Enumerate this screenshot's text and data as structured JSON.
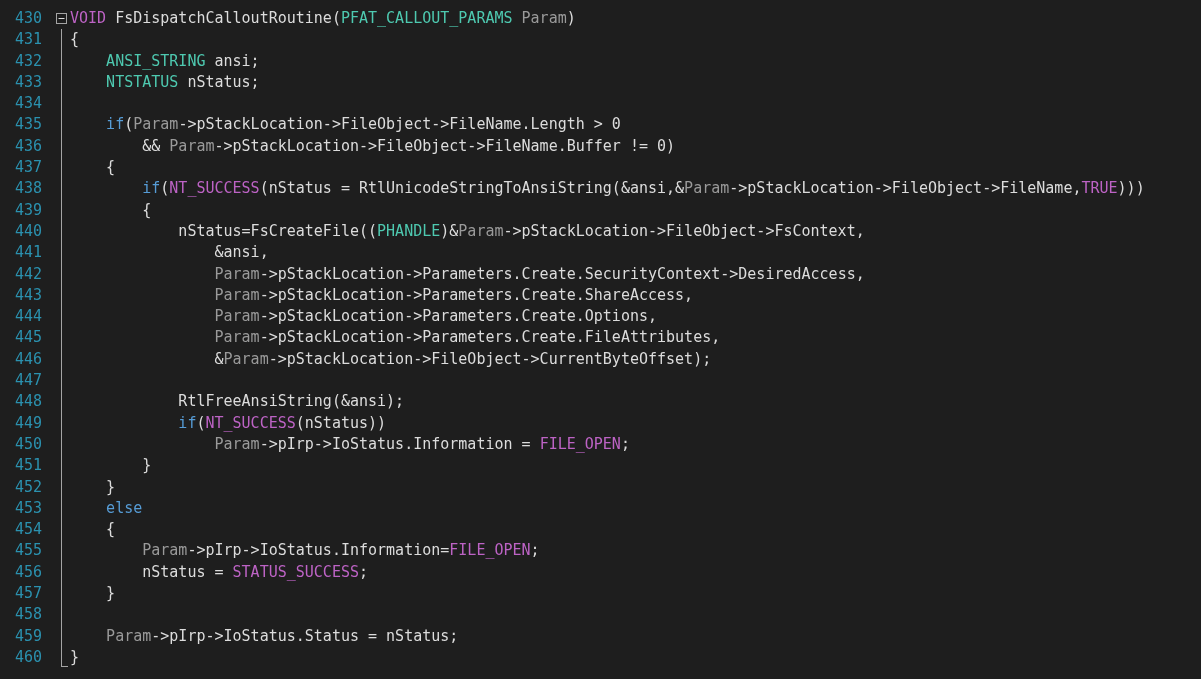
{
  "editor": {
    "fold_region": {
      "expanded": true
    },
    "lines": [
      {
        "number": "430",
        "segments": [
          {
            "text": "VOID",
            "kind": "macro"
          },
          {
            "text": " FsDispatchCalloutRoutine(",
            "kind": "plain"
          },
          {
            "text": "PFAT_CALLOUT_PARAMS ",
            "kind": "type"
          },
          {
            "text": "Param",
            "kind": "param"
          },
          {
            "text": ")",
            "kind": "plain"
          }
        ]
      },
      {
        "number": "431",
        "segments": [
          {
            "text": "{",
            "kind": "plain"
          }
        ]
      },
      {
        "number": "432",
        "segments": [
          {
            "text": "    ANSI_STRING",
            "kind": "type"
          },
          {
            "text": " ansi;",
            "kind": "plain"
          }
        ]
      },
      {
        "number": "433",
        "segments": [
          {
            "text": "    NTSTATUS",
            "kind": "type"
          },
          {
            "text": " nStatus;",
            "kind": "plain"
          }
        ]
      },
      {
        "number": "434"
      },
      {
        "number": "435",
        "segments": [
          {
            "text": "    if",
            "kind": "keyword"
          },
          {
            "text": "(",
            "kind": "plain"
          },
          {
            "text": "Param",
            "kind": "param"
          },
          {
            "text": "->pStackLocation->FileObject->FileName.Length > 0",
            "kind": "plain"
          }
        ]
      },
      {
        "number": "436",
        "segments": [
          {
            "text": "        && ",
            "kind": "plain"
          },
          {
            "text": "Param",
            "kind": "param"
          },
          {
            "text": "->pStackLocation->FileObject->FileName.Buffer != 0)",
            "kind": "plain"
          }
        ]
      },
      {
        "number": "437",
        "segments": [
          {
            "text": "    {",
            "kind": "plain"
          }
        ]
      },
      {
        "number": "438",
        "segments": [
          {
            "text": "        if",
            "kind": "keyword"
          },
          {
            "text": "(",
            "kind": "plain"
          },
          {
            "text": "NT_SUCCESS",
            "kind": "macro"
          },
          {
            "text": "(nStatus = RtlUnicodeStringToAnsiString(&ansi,&",
            "kind": "plain"
          },
          {
            "text": "Param",
            "kind": "param"
          },
          {
            "text": "->pStackLocation->FileObject->FileName,",
            "kind": "plain"
          },
          {
            "text": "TRUE",
            "kind": "macro"
          },
          {
            "text": ")))",
            "kind": "plain"
          }
        ]
      },
      {
        "number": "439",
        "segments": [
          {
            "text": "        {",
            "kind": "plain"
          }
        ]
      },
      {
        "number": "440",
        "segments": [
          {
            "text": "            nStatus=FsCreateFile((",
            "kind": "plain"
          },
          {
            "text": "PHANDLE",
            "kind": "type"
          },
          {
            "text": ")&",
            "kind": "plain"
          },
          {
            "text": "Param",
            "kind": "param"
          },
          {
            "text": "->pStackLocation->FileObject->FsContext,",
            "kind": "plain"
          }
        ]
      },
      {
        "number": "441",
        "segments": [
          {
            "text": "                &ansi,",
            "kind": "plain"
          }
        ]
      },
      {
        "number": "442",
        "segments": [
          {
            "text": "                Param",
            "kind": "param"
          },
          {
            "text": "->pStackLocation->Parameters.Create.SecurityContext->DesiredAccess,",
            "kind": "plain"
          }
        ]
      },
      {
        "number": "443",
        "segments": [
          {
            "text": "                Param",
            "kind": "param"
          },
          {
            "text": "->pStackLocation->Parameters.Create.ShareAccess,",
            "kind": "plain"
          }
        ]
      },
      {
        "number": "444",
        "segments": [
          {
            "text": "                Param",
            "kind": "param"
          },
          {
            "text": "->pStackLocation->Parameters.Create.Options,",
            "kind": "plain"
          }
        ]
      },
      {
        "number": "445",
        "segments": [
          {
            "text": "                Param",
            "kind": "param"
          },
          {
            "text": "->pStackLocation->Parameters.Create.FileAttributes,",
            "kind": "plain"
          }
        ]
      },
      {
        "number": "446",
        "segments": [
          {
            "text": "                &",
            "kind": "plain"
          },
          {
            "text": "Param",
            "kind": "param"
          },
          {
            "text": "->pStackLocation->FileObject->CurrentByteOffset);",
            "kind": "plain"
          }
        ]
      },
      {
        "number": "447"
      },
      {
        "number": "448",
        "segments": [
          {
            "text": "            RtlFreeAnsiString(&ansi);",
            "kind": "plain"
          }
        ]
      },
      {
        "number": "449",
        "segments": [
          {
            "text": "            if",
            "kind": "keyword"
          },
          {
            "text": "(",
            "kind": "plain"
          },
          {
            "text": "NT_SUCCESS",
            "kind": "macro"
          },
          {
            "text": "(nStatus))",
            "kind": "plain"
          }
        ]
      },
      {
        "number": "450",
        "segments": [
          {
            "text": "                Param",
            "kind": "param"
          },
          {
            "text": "->pIrp->IoStatus.Information = ",
            "kind": "plain"
          },
          {
            "text": "FILE_OPEN",
            "kind": "macro"
          },
          {
            "text": ";",
            "kind": "plain"
          }
        ]
      },
      {
        "number": "451",
        "segments": [
          {
            "text": "        }",
            "kind": "plain"
          }
        ]
      },
      {
        "number": "452",
        "segments": [
          {
            "text": "    }",
            "kind": "plain"
          }
        ]
      },
      {
        "number": "453",
        "segments": [
          {
            "text": "    else",
            "kind": "keyword"
          }
        ]
      },
      {
        "number": "454",
        "segments": [
          {
            "text": "    {",
            "kind": "plain"
          }
        ]
      },
      {
        "number": "455",
        "segments": [
          {
            "text": "        Param",
            "kind": "param"
          },
          {
            "text": "->pIrp->IoStatus.Information=",
            "kind": "plain"
          },
          {
            "text": "FILE_OPEN",
            "kind": "macro"
          },
          {
            "text": ";",
            "kind": "plain"
          }
        ]
      },
      {
        "number": "456",
        "segments": [
          {
            "text": "        nStatus = ",
            "kind": "plain"
          },
          {
            "text": "STATUS_SUCCESS",
            "kind": "macro"
          },
          {
            "text": ";",
            "kind": "plain"
          }
        ]
      },
      {
        "number": "457",
        "segments": [
          {
            "text": "    }",
            "kind": "plain"
          }
        ]
      },
      {
        "number": "458"
      },
      {
        "number": "459",
        "segments": [
          {
            "text": "    Param",
            "kind": "param"
          },
          {
            "text": "->pIrp->IoStatus.Status = nStatus;",
            "kind": "plain"
          }
        ]
      },
      {
        "number": "460",
        "segments": [
          {
            "text": "}",
            "kind": "plain"
          }
        ]
      }
    ]
  }
}
